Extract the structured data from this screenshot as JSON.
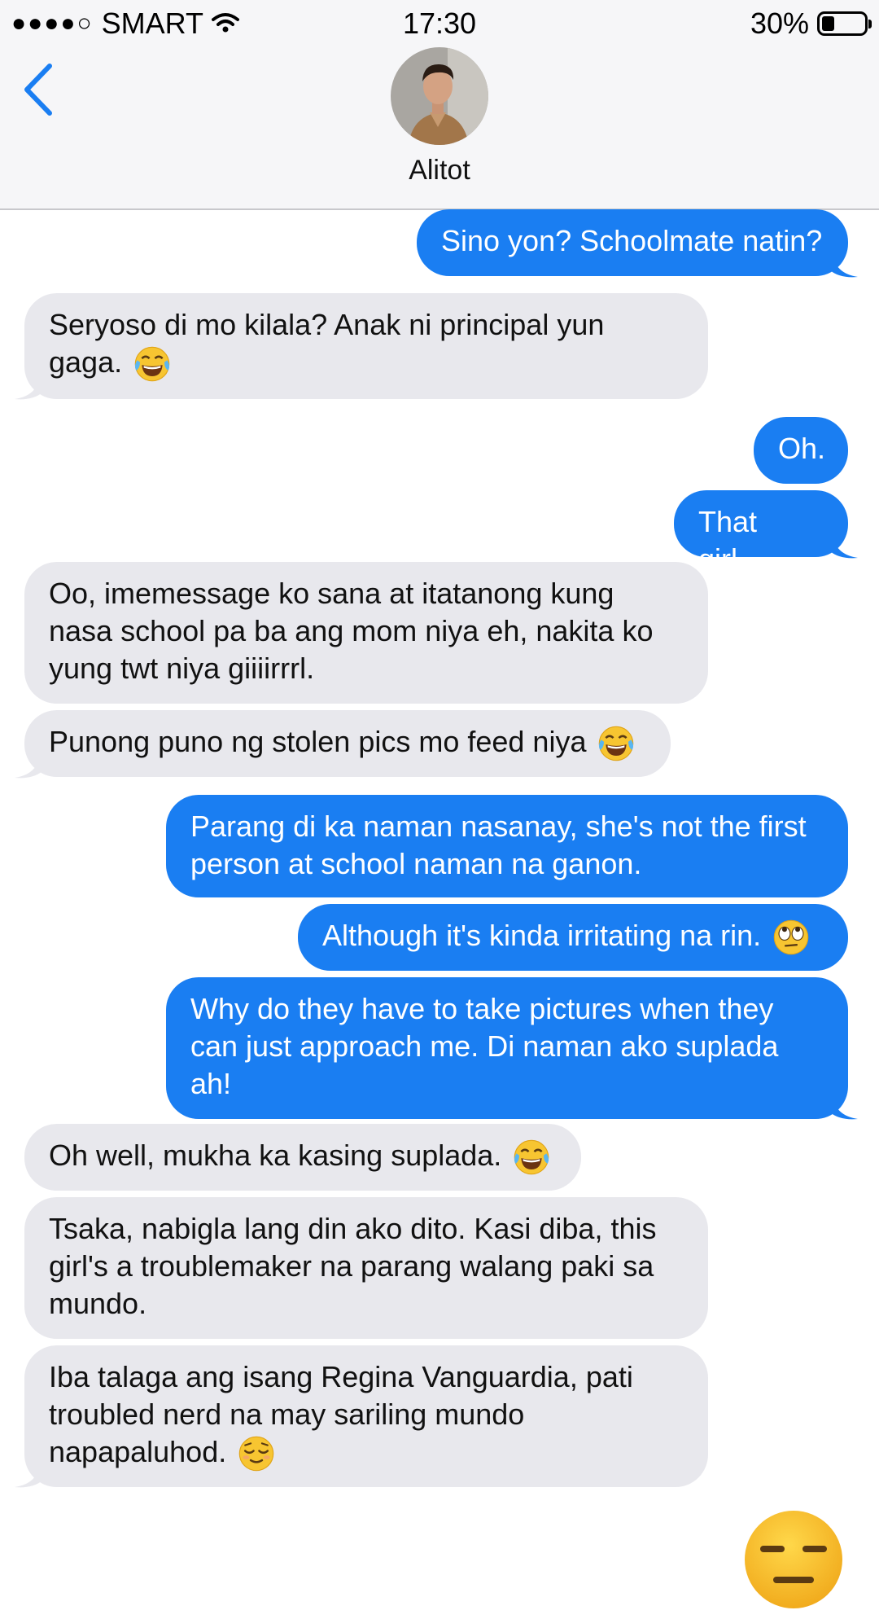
{
  "status_bar": {
    "signal": "●●●●○",
    "carrier": "SMART",
    "time": "17:30",
    "battery_percent_label": "30%",
    "battery_level": 0.3
  },
  "header": {
    "contact_name": "Alitot"
  },
  "icons": {
    "back": "chevron-left-icon",
    "wifi": "wifi-icon",
    "battery": "battery-icon",
    "avatar": "contact-avatar"
  },
  "colors": {
    "sent_bubble": "#1a7ef2",
    "received_bubble": "#e8e8ed",
    "header_bg": "#f6f6f8",
    "accent": "#1a7ef2"
  },
  "messages": [
    {
      "from": "me",
      "text": "Sino yon? Schoolmate natin?"
    },
    {
      "from": "them",
      "text": "Seryoso di mo kilala? Anak ni principal yun gaga.",
      "emoji": "laughing-tears-emoji"
    },
    {
      "from": "me",
      "text": "Oh."
    },
    {
      "from": "me",
      "text": "That girl..."
    },
    {
      "from": "them",
      "text": "Oo, imemessage ko sana at itatanong kung nasa school pa ba ang mom niya eh, nakita ko yung twt niya giiiirrrl."
    },
    {
      "from": "them",
      "text": "Punong puno ng stolen pics mo feed niya",
      "emoji": "laughing-tears-emoji"
    },
    {
      "from": "me",
      "text": "Parang di ka naman nasanay, she's not the first person at school naman na ganon."
    },
    {
      "from": "me",
      "text": "Although it's kinda irritating na rin.",
      "emoji": "eye-roll-emoji"
    },
    {
      "from": "me",
      "text": "Why do they have to take pictures when they can just approach me. Di naman ako suplada ah!"
    },
    {
      "from": "them",
      "text": "Oh well, mukha ka kasing suplada.",
      "emoji": "laughing-tears-emoji"
    },
    {
      "from": "them",
      "text": "Tsaka, nabigla lang din ako dito. Kasi diba, this girl's a troublemaker na parang walang paki sa mundo."
    },
    {
      "from": "them",
      "text": "Iba talaga ang isang Regina Vanguardia, pati troubled nerd na may sariling mundo napapaluhod.",
      "emoji": "relieved-face-emoji"
    },
    {
      "from": "me",
      "emoji": "expressionless-face-emoji"
    }
  ]
}
